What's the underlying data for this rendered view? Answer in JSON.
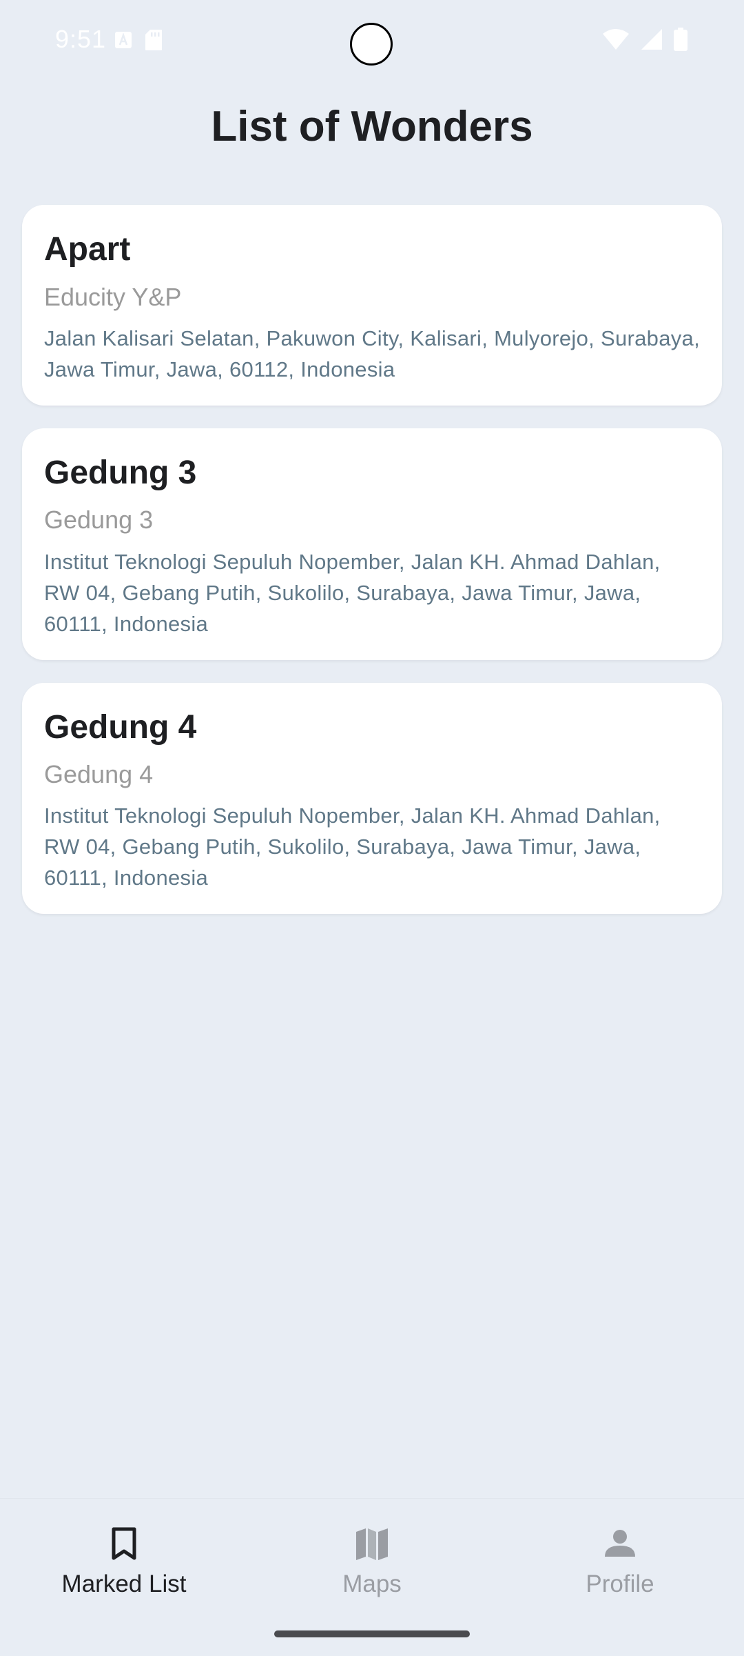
{
  "status_bar": {
    "time": "9:51",
    "icons": [
      "text-a-icon",
      "sd-card-icon",
      "wifi-icon",
      "signal-icon",
      "battery-icon"
    ]
  },
  "page": {
    "title": "List of Wonders"
  },
  "cards": [
    {
      "title": "Apart",
      "subtitle": "Educity Y&P",
      "address": "Jalan Kalisari Selatan, Pakuwon City, Kalisari, Mulyorejo, Surabaya, Jawa Timur, Jawa, 60112, Indonesia"
    },
    {
      "title": "Gedung 3",
      "subtitle": "Gedung 3",
      "address": "Institut Teknologi Sepuluh Nopember, Jalan KH. Ahmad Dahlan, RW 04, Gebang Putih, Sukolilo, Surabaya, Jawa Timur, Jawa, 60111, Indonesia"
    },
    {
      "title": "Gedung 4",
      "subtitle": "Gedung 4",
      "address": "Institut Teknologi Sepuluh Nopember, Jalan KH. Ahmad Dahlan, RW 04, Gebang Putih, Sukolilo, Surabaya, Jawa Timur, Jawa, 60111, Indonesia"
    }
  ],
  "bottom_nav": {
    "items": [
      {
        "label": "Marked List",
        "icon": "bookmark-icon",
        "active": true
      },
      {
        "label": "Maps",
        "icon": "map-icon",
        "active": false
      },
      {
        "label": "Profile",
        "icon": "person-icon",
        "active": false
      }
    ]
  },
  "colors": {
    "background": "#E8EDF4",
    "card": "#FFFFFF",
    "title_text": "#1E1F22",
    "subtitle_text": "#9A9A9A",
    "address_text": "#607888",
    "nav_inactive": "#9A9DA3"
  }
}
